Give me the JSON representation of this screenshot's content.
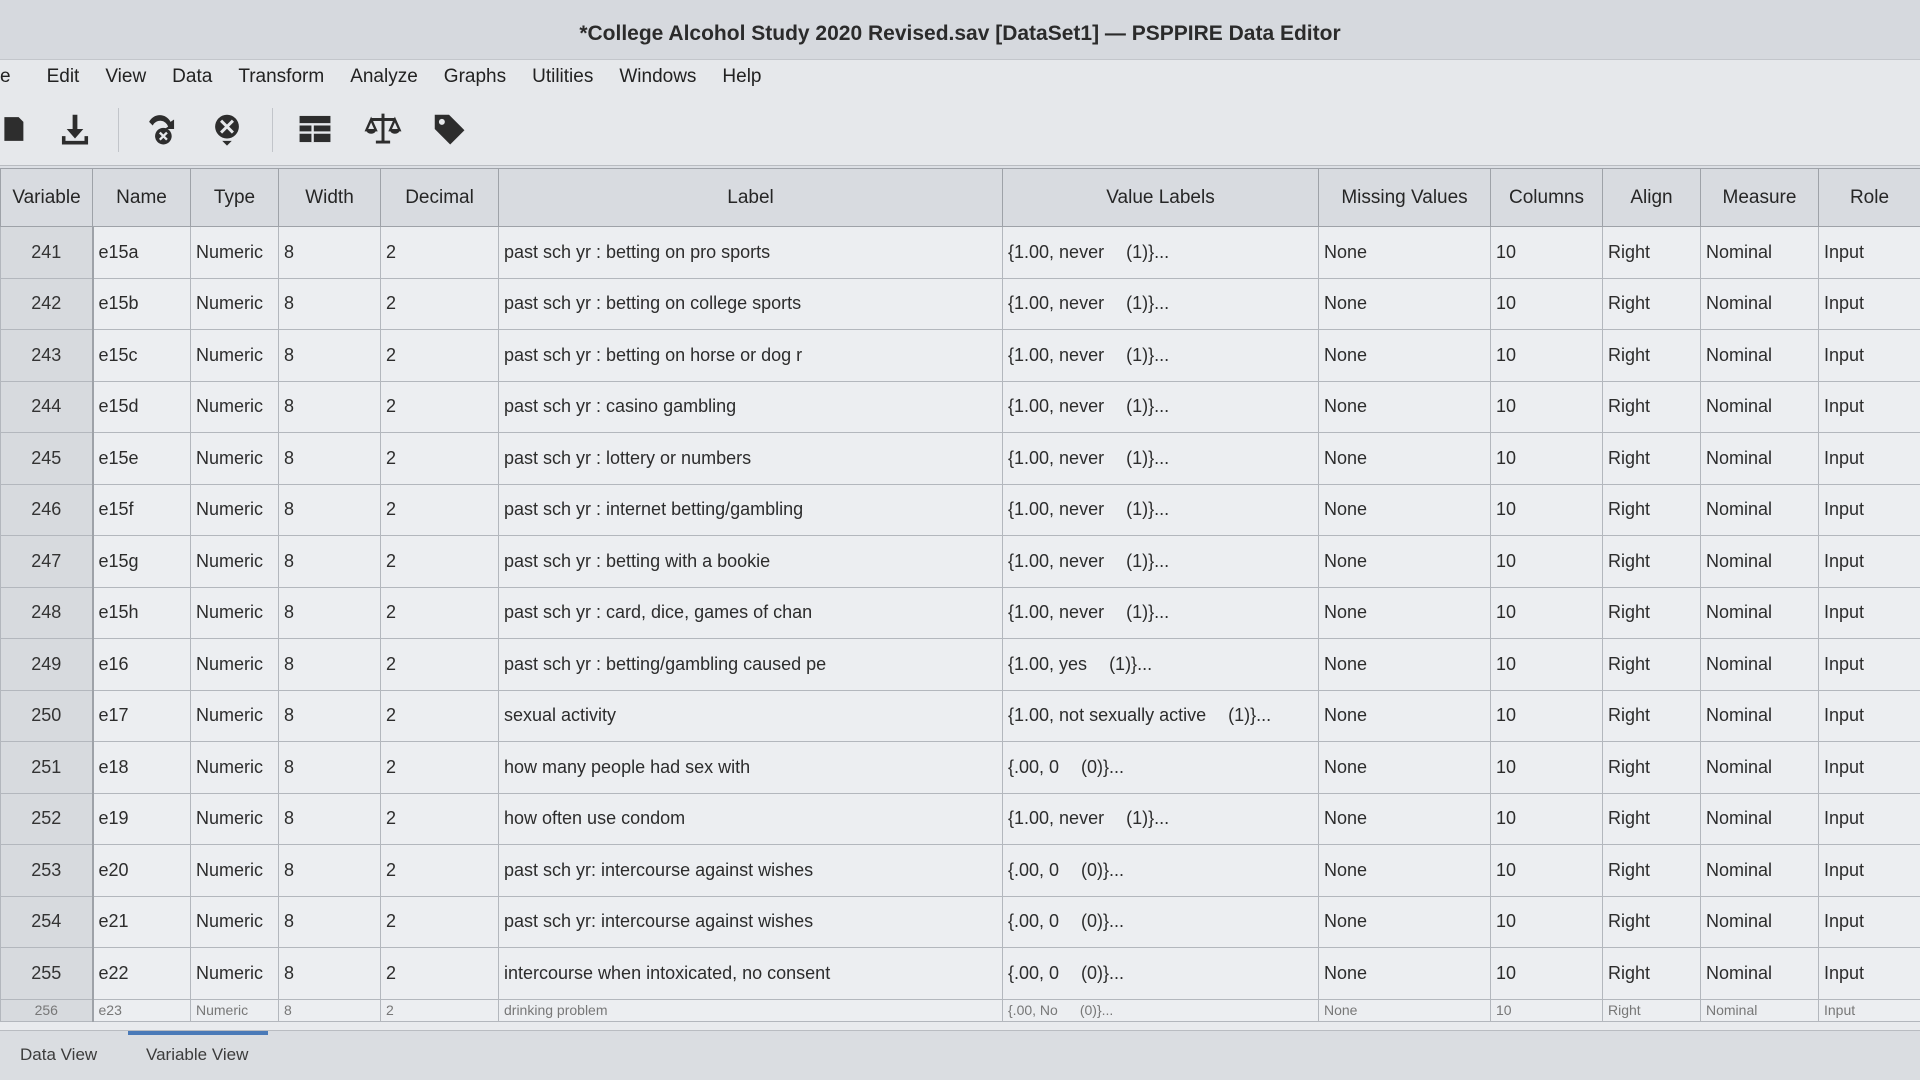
{
  "window": {
    "title": "*College Alcohol Study 2020 Revised.sav [DataSet1] — PSPPIRE Data Editor"
  },
  "menu": [
    "e",
    "Edit",
    "View",
    "Data",
    "Transform",
    "Analyze",
    "Graphs",
    "Utilities",
    "Windows",
    "Help"
  ],
  "toolbar": [
    "open-file-icon",
    "save-icon",
    "goto-case-icon",
    "delete-icon",
    "split-file-icon",
    "weight-cases-icon",
    "value-labels-icon"
  ],
  "columns": [
    "Variable",
    "Name",
    "Type",
    "Width",
    "Decimal",
    "Label",
    "Value Labels",
    "Missing Values",
    "Columns",
    "Align",
    "Measure",
    "Role"
  ],
  "rows": [
    [
      "241",
      "e15a",
      "Numeric",
      "8",
      "2",
      "past sch yr :  betting on pro sports",
      "{1.00, never",
      "(1)}...",
      "None",
      "10",
      "Right",
      "Nominal",
      "Input"
    ],
    [
      "242",
      "e15b",
      "Numeric",
      "8",
      "2",
      "past sch yr :  betting on college sports",
      "{1.00, never",
      "(1)}...",
      "None",
      "10",
      "Right",
      "Nominal",
      "Input"
    ],
    [
      "243",
      "e15c",
      "Numeric",
      "8",
      "2",
      "past sch yr :  betting on horse or dog r",
      "{1.00, never",
      "(1)}...",
      "None",
      "10",
      "Right",
      "Nominal",
      "Input"
    ],
    [
      "244",
      "e15d",
      "Numeric",
      "8",
      "2",
      "past sch yr :  casino gambling",
      "{1.00, never",
      "(1)}...",
      "None",
      "10",
      "Right",
      "Nominal",
      "Input"
    ],
    [
      "245",
      "e15e",
      "Numeric",
      "8",
      "2",
      "past sch yr :  lottery or numbers",
      "{1.00, never",
      "(1)}...",
      "None",
      "10",
      "Right",
      "Nominal",
      "Input"
    ],
    [
      "246",
      "e15f",
      "Numeric",
      "8",
      "2",
      "past sch yr :  internet betting/gambling",
      "{1.00, never",
      "(1)}...",
      "None",
      "10",
      "Right",
      "Nominal",
      "Input"
    ],
    [
      "247",
      "e15g",
      "Numeric",
      "8",
      "2",
      "past sch yr :  betting with a bookie",
      "{1.00, never",
      "(1)}...",
      "None",
      "10",
      "Right",
      "Nominal",
      "Input"
    ],
    [
      "248",
      "e15h",
      "Numeric",
      "8",
      "2",
      "past sch yr :  card, dice, games of chan",
      "{1.00, never",
      "(1)}...",
      "None",
      "10",
      "Right",
      "Nominal",
      "Input"
    ],
    [
      "249",
      "e16",
      "Numeric",
      "8",
      "2",
      "past sch yr : betting/gambling caused pe",
      "{1.00, yes",
      "(1)}...",
      "None",
      "10",
      "Right",
      "Nominal",
      "Input"
    ],
    [
      "250",
      "e17",
      "Numeric",
      "8",
      "2",
      "sexual activity",
      "{1.00, not sexually active",
      "(1)}...",
      "None",
      "10",
      "Right",
      "Nominal",
      "Input"
    ],
    [
      "251",
      "e18",
      "Numeric",
      "8",
      "2",
      "how many people had sex with",
      "{.00, 0",
      "(0)}...",
      "None",
      "10",
      "Right",
      "Nominal",
      "Input"
    ],
    [
      "252",
      "e19",
      "Numeric",
      "8",
      "2",
      "how often use condom",
      "{1.00, never",
      "(1)}...",
      "None",
      "10",
      "Right",
      "Nominal",
      "Input"
    ],
    [
      "253",
      "e20",
      "Numeric",
      "8",
      "2",
      "past sch yr: intercourse against wishes",
      "{.00, 0",
      "(0)}...",
      "None",
      "10",
      "Right",
      "Nominal",
      "Input"
    ],
    [
      "254",
      "e21",
      "Numeric",
      "8",
      "2",
      "past sch yr: intercourse against wishes",
      "{.00, 0",
      "(0)}...",
      "None",
      "10",
      "Right",
      "Nominal",
      "Input"
    ],
    [
      "255",
      "e22",
      "Numeric",
      "8",
      "2",
      "intercourse when intoxicated, no consent",
      "{.00, 0",
      "(0)}...",
      "None",
      "10",
      "Right",
      "Nominal",
      "Input"
    ]
  ],
  "partial_row": [
    "256",
    "e23",
    "Numeric",
    "8",
    "2",
    "drinking problem",
    "{.00, No",
    "(0)}...",
    "None",
    "10",
    "Right",
    "Nominal",
    "Input"
  ],
  "tabs": {
    "data_view": "Data View",
    "variable_view": "Variable View"
  }
}
